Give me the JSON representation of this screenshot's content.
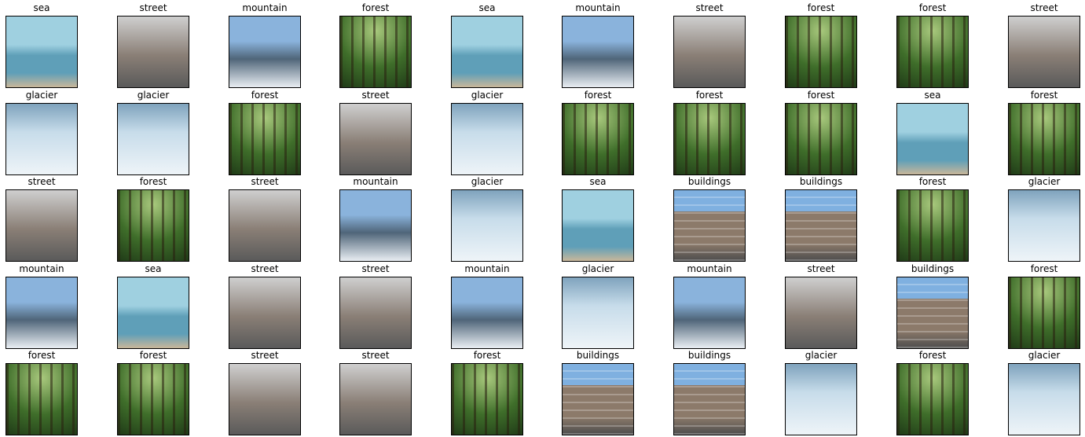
{
  "rows": [
    [
      "sea",
      "street",
      "mountain",
      "forest",
      "sea",
      "mountain",
      "street",
      "forest",
      "forest",
      "street"
    ],
    [
      "glacier",
      "glacier",
      "forest",
      "street",
      "glacier",
      "forest",
      "forest",
      "forest",
      "sea",
      "forest"
    ],
    [
      "street",
      "forest",
      "street",
      "mountain",
      "glacier",
      "sea",
      "buildings",
      "buildings",
      "forest",
      "glacier"
    ],
    [
      "mountain",
      "sea",
      "street",
      "street",
      "mountain",
      "glacier",
      "mountain",
      "street",
      "buildings",
      "forest"
    ],
    [
      "forest",
      "forest",
      "street",
      "street",
      "forest",
      "buildings",
      "buildings",
      "glacier",
      "forest",
      "glacier"
    ]
  ],
  "palettes": {
    "sea": [
      "#9fd0e0",
      "#5f9fb8",
      "#c9b79a"
    ],
    "street": [
      "#cfcfcf",
      "#8a7f76",
      "#5a5a5a"
    ],
    "mountain": [
      "#8ab3dc",
      "#4f6579",
      "#e9eef3"
    ],
    "forest": [
      "#a9c97d",
      "#3f6e2a",
      "#1f3a17"
    ],
    "glacier": [
      "#c7dcea",
      "#7fa3bd",
      "#eef4f8"
    ],
    "buildings": [
      "#7fb0e0",
      "#8c7a6a",
      "#4d4d4d"
    ]
  },
  "icons": {
    "sea": "sea-photo-icon",
    "street": "street-photo-icon",
    "mountain": "mountain-photo-icon",
    "forest": "forest-photo-icon",
    "glacier": "glacier-photo-icon",
    "buildings": "buildings-photo-icon"
  }
}
